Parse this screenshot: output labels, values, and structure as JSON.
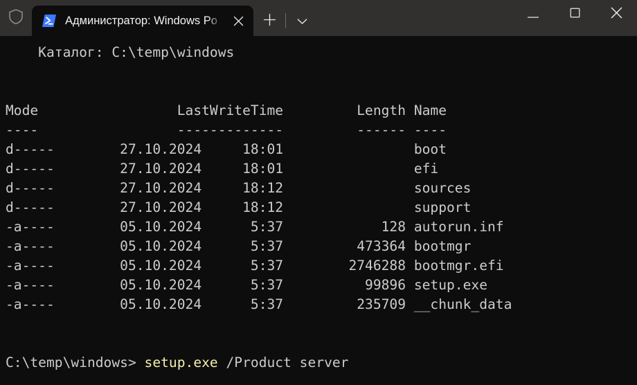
{
  "titlebar": {
    "shield_icon": "shield-icon",
    "tab": {
      "icon": "powershell-icon",
      "title": "Администратор: Windows Po",
      "close_icon": "close-icon"
    },
    "new_tab_icon": "plus-icon",
    "dropdown_icon": "chevron-down-icon",
    "minimize_icon": "minimize-icon",
    "maximize_icon": "maximize-icon",
    "close_icon": "close-icon"
  },
  "terminal": {
    "directory_line": "    Каталог: C:\\temp\\windows",
    "blank_1": "",
    "blank_2": "",
    "header": "Mode                 LastWriteTime         Length Name",
    "header_rule": "----                 -------------         ------ ----",
    "rows": [
      "d-----        27.10.2024     18:01                boot",
      "d-----        27.10.2024     18:01                efi",
      "d-----        27.10.2024     18:12                sources",
      "d-----        27.10.2024     18:12                support",
      "-a----        05.10.2024      5:37            128 autorun.inf",
      "-a----        05.10.2024      5:37         473364 bootmgr",
      "-a----        05.10.2024      5:37        2746288 bootmgr.efi",
      "-a----        05.10.2024      5:37          99896 setup.exe",
      "-a----        05.10.2024      5:37         235709 __chunk_data"
    ],
    "prompt": {
      "path": "C:\\temp\\windows> ",
      "command": "setup.exe",
      "args": " /Product server"
    },
    "columns": [
      "Mode",
      "LastWriteTime",
      "Length",
      "Name"
    ],
    "entries": [
      {
        "mode": "d-----",
        "date": "27.10.2024",
        "time": "18:01",
        "length": "",
        "name": "boot"
      },
      {
        "mode": "d-----",
        "date": "27.10.2024",
        "time": "18:01",
        "length": "",
        "name": "efi"
      },
      {
        "mode": "d-----",
        "date": "27.10.2024",
        "time": "18:12",
        "length": "",
        "name": "sources"
      },
      {
        "mode": "d-----",
        "date": "27.10.2024",
        "time": "18:12",
        "length": "",
        "name": "support"
      },
      {
        "mode": "-a----",
        "date": "05.10.2024",
        "time": "5:37",
        "length": "128",
        "name": "autorun.inf"
      },
      {
        "mode": "-a----",
        "date": "05.10.2024",
        "time": "5:37",
        "length": "473364",
        "name": "bootmgr"
      },
      {
        "mode": "-a----",
        "date": "05.10.2024",
        "time": "5:37",
        "length": "2746288",
        "name": "bootmgr.efi"
      },
      {
        "mode": "-a----",
        "date": "05.10.2024",
        "time": "5:37",
        "length": "99896",
        "name": "setup.exe"
      },
      {
        "mode": "-a----",
        "date": "05.10.2024",
        "time": "5:37",
        "length": "235709",
        "name": "__chunk_data"
      }
    ]
  },
  "colors": {
    "titlebar_bg": "#32302f",
    "terminal_bg": "#0d0d0d",
    "text": "#cccccc",
    "command_yellow": "#f4eead",
    "powershell_blue": "#3b78ff"
  }
}
